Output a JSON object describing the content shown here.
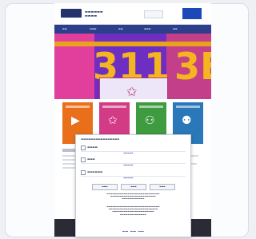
{
  "colors": {
    "navy": "#24336b",
    "hero_purple": "#8a2fc0",
    "hero_pink": "#e23f9d",
    "hero_yellow": "#f4b51f",
    "tile_orange": "#e96f1b",
    "tile_pink": "#d23c86",
    "tile_green": "#3f9b3f",
    "tile_blue": "#2a78b9"
  },
  "hero": {
    "digits_left": "311",
    "digits_right": "3E",
    "icon": "star-icon"
  },
  "tiles": [
    {
      "icon": "play-icon",
      "color": "#e96f1b"
    },
    {
      "icon": "star-icon",
      "color": "#d23c86"
    },
    {
      "icon": "people-icon",
      "color": "#3f9b3f"
    },
    {
      "icon": "group-icon",
      "color": "#2a78b9"
    }
  ]
}
